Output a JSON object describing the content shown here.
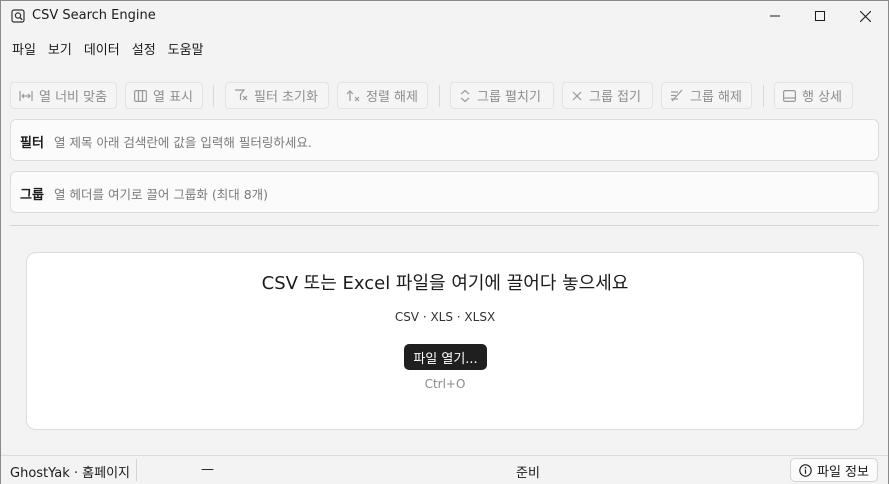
{
  "window": {
    "title": "CSV Search Engine",
    "icons": [
      "app-icon",
      "minimize-icon",
      "maximize-icon",
      "close-icon"
    ]
  },
  "menu": {
    "items": [
      "파일",
      "보기",
      "데이터",
      "설정",
      "도움말"
    ]
  },
  "toolbar": {
    "fit_columns": "열 너비 맞춤",
    "show_columns": "열 표시",
    "reset_filter": "필터 초기화",
    "clear_sort": "정렬 해제",
    "expand_groups": "그룹 펼치기",
    "collapse_groups": "그룹 접기",
    "ungroup": "그룹 해제",
    "row_detail": "행 상세"
  },
  "filter_panel": {
    "label": "필터",
    "hint": "열 제목 아래 검색란에 값을 입력해 필터링하세요."
  },
  "group_panel": {
    "label": "그룹",
    "hint": "열 헤더를 여기로 끌어 그룹화 (최대 8개)"
  },
  "dropzone": {
    "title": "CSV 또는 Excel 파일을 여기에 끌어다 놓으세요",
    "formats": "CSV · XLS · XLSX",
    "open_button": "파일 열기...",
    "shortcut": "Ctrl+O"
  },
  "status": {
    "left": "GhostYak · 홈페이지",
    "dash": "—",
    "center": "준비",
    "info_button": "파일 정보"
  }
}
